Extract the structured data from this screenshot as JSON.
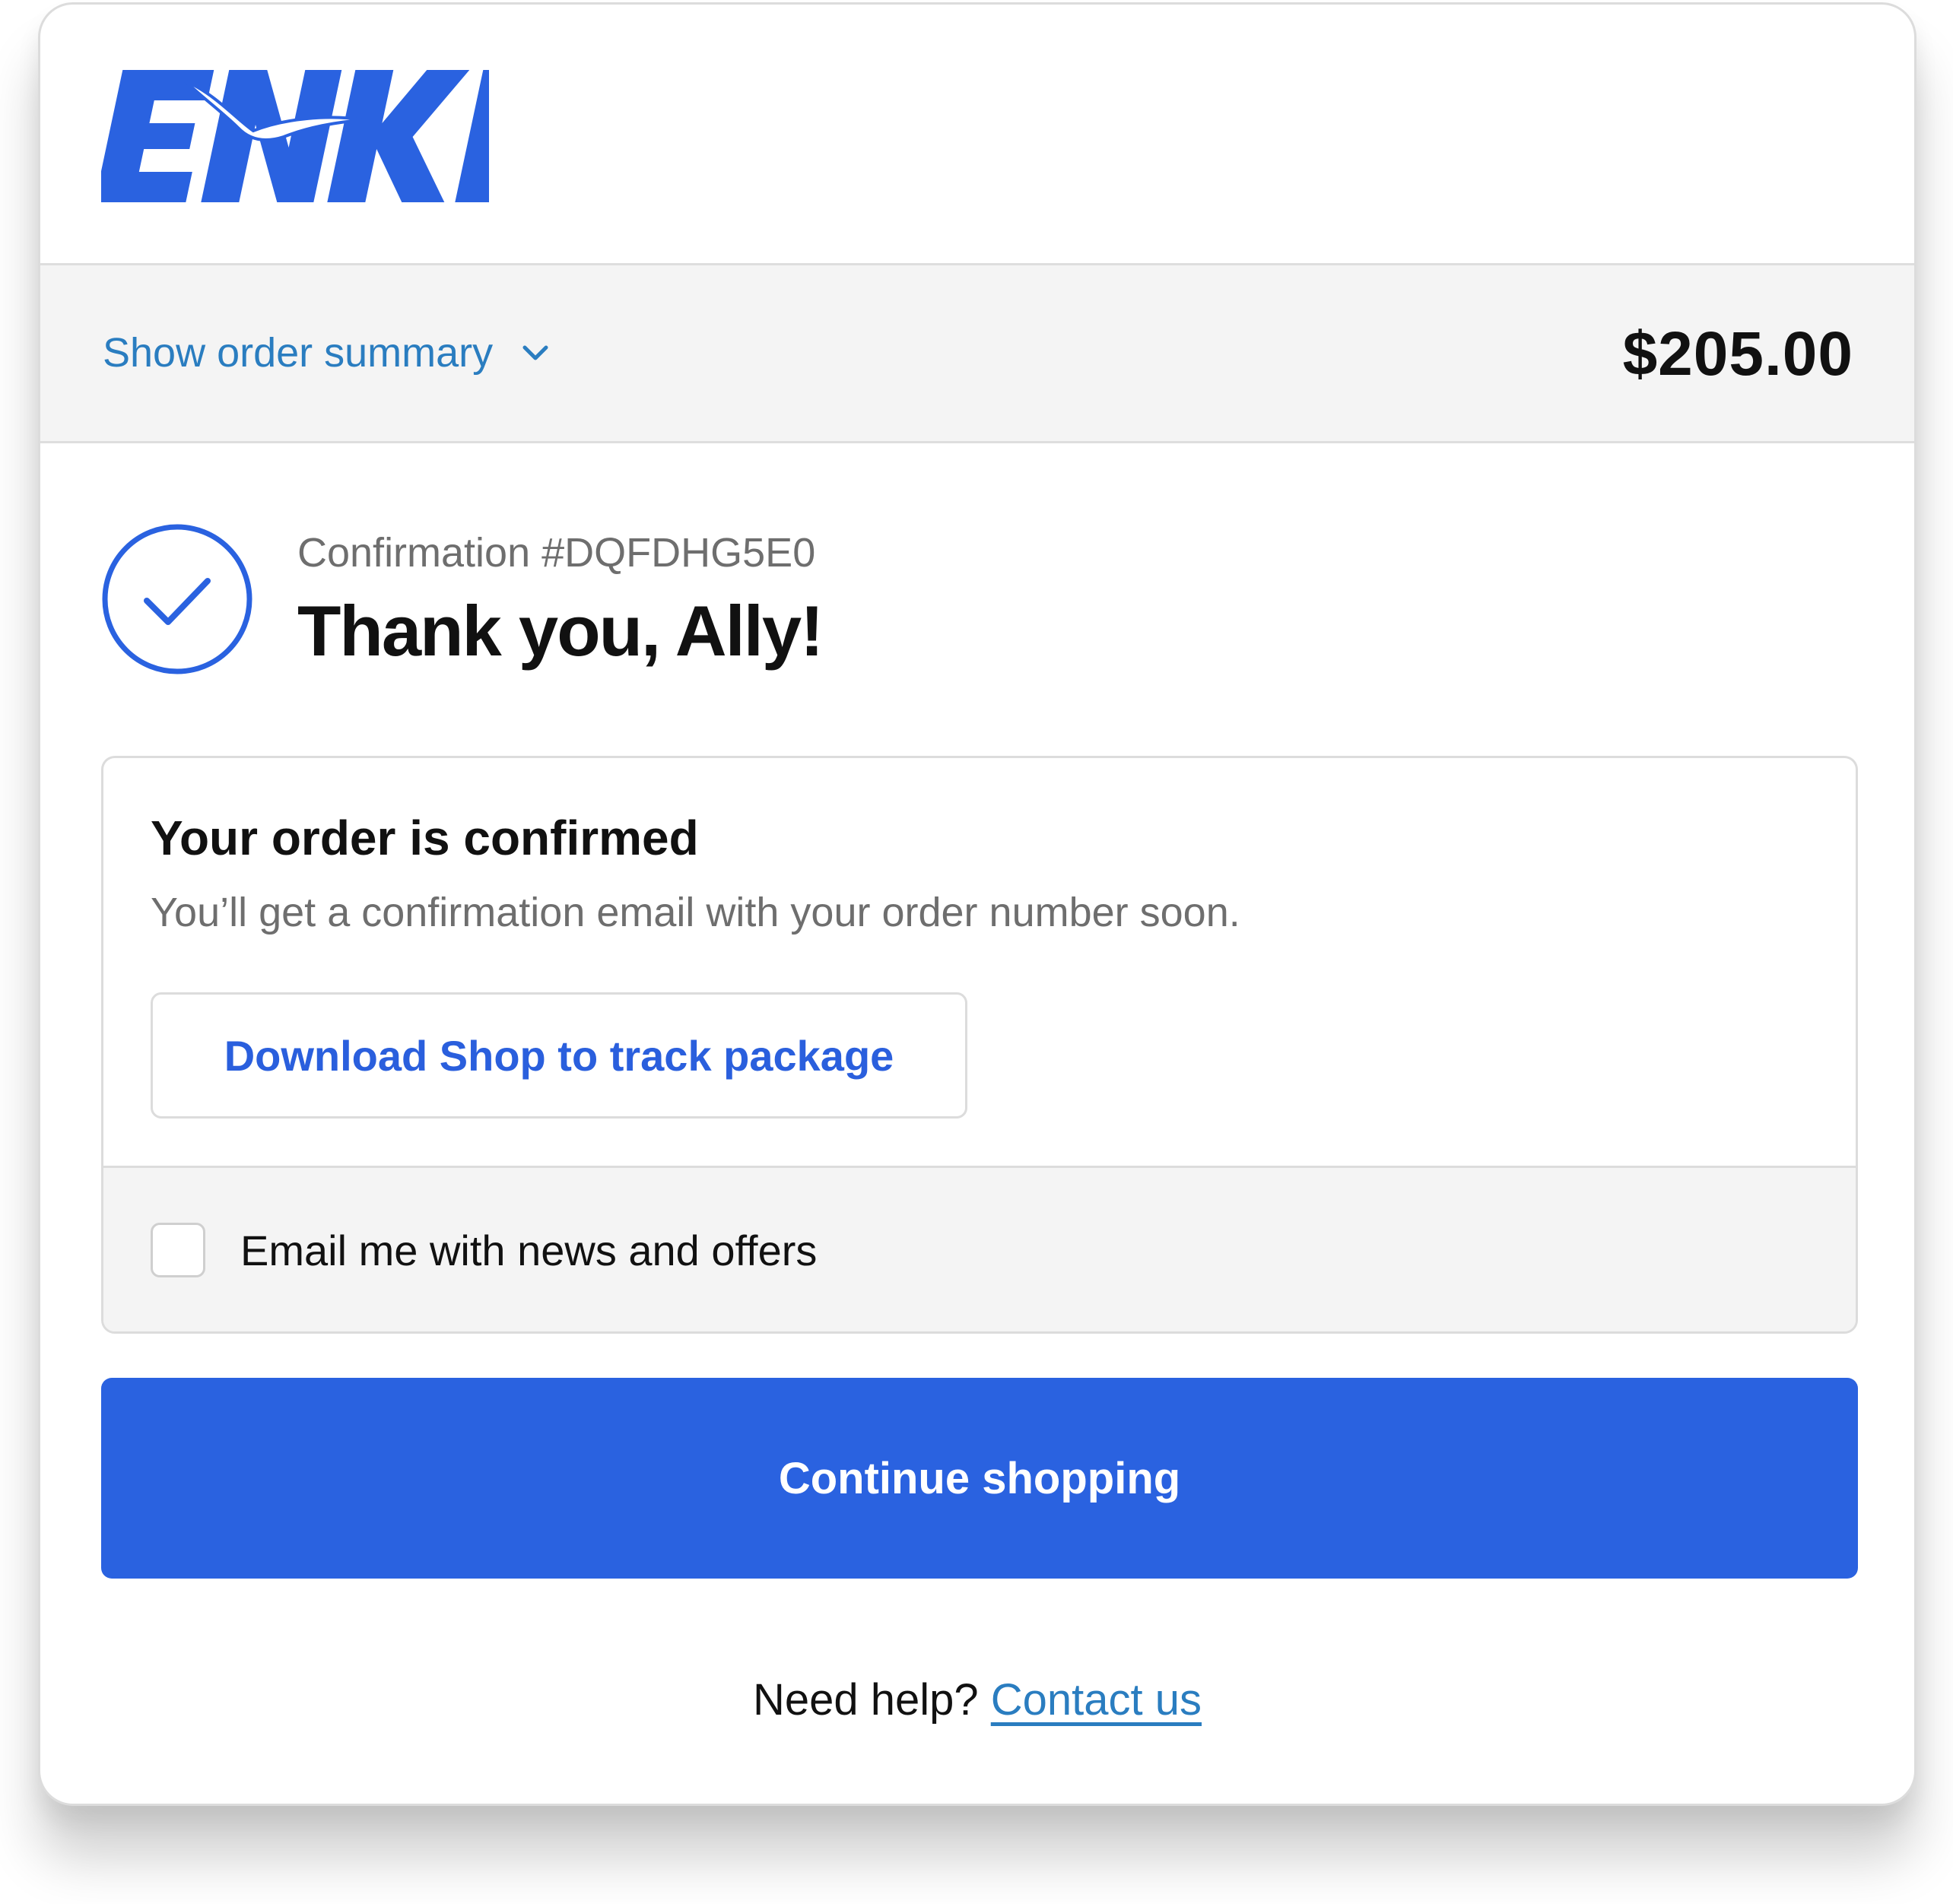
{
  "brand": {
    "logo_text": "ENKI",
    "color": "#2a62e0"
  },
  "summary": {
    "toggle_label": "Show order summary",
    "toggle_icon": "chevron-down-icon",
    "total": "$205.00"
  },
  "confirmation": {
    "icon": "checkmark-circle-icon",
    "number": "Confirmation #DQFDHG5E0",
    "greeting": "Thank you, Ally!"
  },
  "order_status": {
    "heading": "Your order is confirmed",
    "text": "You’ll get a confirmation email with your order number soon.",
    "download_button": "Download Shop to track package"
  },
  "newsletter": {
    "label": "Email me with news and offers",
    "checked": false
  },
  "actions": {
    "continue_button": "Continue shopping"
  },
  "help": {
    "prefix": "Need help?",
    "link": "Contact us"
  },
  "colors": {
    "accent": "#2a62e0",
    "link": "#2a7dc0",
    "muted_text": "#6e6e6e",
    "panel_bg": "#f4f4f4"
  }
}
